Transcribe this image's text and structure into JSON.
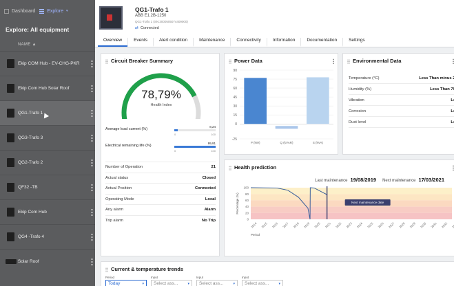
{
  "nav": {
    "dashboard_label": "Dashboard",
    "explore_label": "Explore"
  },
  "sidebar": {
    "title": "Explore: All equipment",
    "column_header": "NAME ▲",
    "items": [
      {
        "label": "Ekip COM Hub - EV-CHG-PKR"
      },
      {
        "label": "Ekip Com Hub Solar Roof"
      },
      {
        "label": "QG1-Trafo 1"
      },
      {
        "label": "QG3-Trafo 3"
      },
      {
        "label": "QG2-Trafo 2"
      },
      {
        "label": "QF32 -TB"
      },
      {
        "label": "Ekip Com Hub"
      },
      {
        "label": "QG4 -Trafo 4"
      },
      {
        "label": "Solar Roof"
      }
    ]
  },
  "device": {
    "title": "QG1-Trafo 1",
    "model": "ABB E1.2B-1250",
    "serial": "QG1-Trafo 1 (SN:3000505074409000)",
    "status": "Connected"
  },
  "tabs": [
    "Overview",
    "Events",
    "Alert condition",
    "Maintenance",
    "Connectivity",
    "Information",
    "Documentation",
    "Settings"
  ],
  "cb_summary": {
    "title": "Circuit Breaker Summary",
    "health_index_value": "78,79%",
    "health_index_fraction": 0.7879,
    "health_index_label": "Health Index",
    "bars": [
      {
        "label": "Average load current (%)",
        "value": "8,24",
        "min": "0",
        "max": "100",
        "fraction": 0.0824
      },
      {
        "label": "Electrical remaining life (%)",
        "value": "99,91",
        "min": "0",
        "max": "100",
        "fraction": 0.9991
      }
    ],
    "rows": [
      {
        "key": "Number of Operation",
        "value": "21"
      },
      {
        "key": "Actual status",
        "value": "Closed"
      },
      {
        "key": "Actual Position",
        "value": "Connected"
      },
      {
        "key": "Operating Mode",
        "value": "Local"
      },
      {
        "key": "Any alarm",
        "value": "Alarm"
      },
      {
        "key": "Trip alarm",
        "value": "No Trip"
      }
    ]
  },
  "power": {
    "title": "Power Data"
  },
  "environmental": {
    "title": "Environmental Data",
    "rows": [
      {
        "key": "Temperature (°C)",
        "value": "Less Than minus 25°"
      },
      {
        "key": "Humidity (%)",
        "value": "Less Than 70%"
      },
      {
        "key": "Vibration",
        "value": "Low"
      },
      {
        "key": "Corrosion",
        "value": "Low"
      },
      {
        "key": "Dust level",
        "value": "Low"
      }
    ]
  },
  "health_prediction": {
    "title": "Health prediction",
    "last_maintenance_label": "Last maintenance",
    "last_maintenance_date": "19/08/2019",
    "next_maintenance_label": "Next maintenance",
    "next_maintenance_date": "17/03/2021",
    "marker_label": "Next maintenance date"
  },
  "trends": {
    "title": "Current & temperature trends",
    "controls": [
      {
        "label": "Period",
        "value": "Today"
      },
      {
        "label": "Input",
        "value": "Select ass..."
      },
      {
        "label": "Input",
        "value": "Select ass..."
      },
      {
        "label": "Input",
        "value": "Select ass..."
      }
    ]
  },
  "colors": {
    "accent": "#2a6ad1",
    "gauge_fill": "#1fa04a",
    "bar_dark": "#4a86d0",
    "bar_light": "#b9d4ef",
    "sidebar_bg": "#5b5c5e"
  },
  "chart_data": [
    {
      "type": "bar",
      "categories": [
        "P (kW)",
        "Q (kVAR)",
        "S (kVA)"
      ],
      "values": [
        77,
        -8,
        78
      ],
      "title": "Power Data",
      "ylim": [
        -25,
        90
      ],
      "yticks": [
        -25,
        0,
        15,
        30,
        45,
        60,
        75,
        90
      ],
      "grid": true
    },
    {
      "type": "line",
      "title": "Health prediction",
      "xlabel": "Period",
      "ylabel": "Percentage (%)",
      "x": [
        "2014",
        "2015",
        "2016",
        "2017",
        "2018",
        "2019",
        "2020",
        "2021",
        "2022",
        "2023",
        "2024",
        "2025",
        "2026",
        "2027",
        "2028",
        "2029",
        "2030",
        "2031",
        "2032",
        "2033"
      ],
      "yticks": [
        0,
        20,
        40,
        60,
        80,
        100
      ],
      "ylim": [
        0,
        100
      ],
      "series": [
        {
          "points": [
            [
              2014.0,
              100
            ],
            [
              2016.5,
              99
            ],
            [
              2017.5,
              92
            ],
            [
              2018.5,
              70
            ],
            [
              2019.4,
              35
            ],
            [
              2019.6,
              0
            ],
            [
              2019.62,
              100
            ],
            [
              2020.0,
              99
            ],
            [
              2020.8,
              85
            ],
            [
              2021.2,
              78
            ]
          ]
        }
      ],
      "marker_year": 2021.2
    }
  ]
}
